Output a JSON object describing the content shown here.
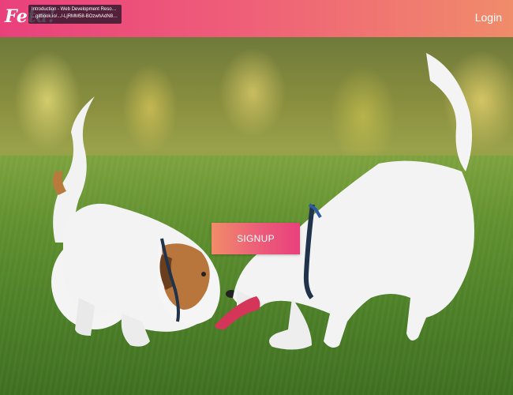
{
  "header": {
    "logo_text": "Feta!",
    "login_label": "Login",
    "tooltip": {
      "line1": "Introduction - Web Development Resource Lib...",
      "line2": "...gitbook.io/.../-LjRMM58-BOzwhAdN8dz/"
    },
    "gradient_start": "#e9407c",
    "gradient_end": "#f08c6a"
  },
  "hero": {
    "image_subject": "two jack russell terriers playing tug with a pink toy on grass"
  },
  "cta": {
    "signup_label": "SIGNUP"
  }
}
